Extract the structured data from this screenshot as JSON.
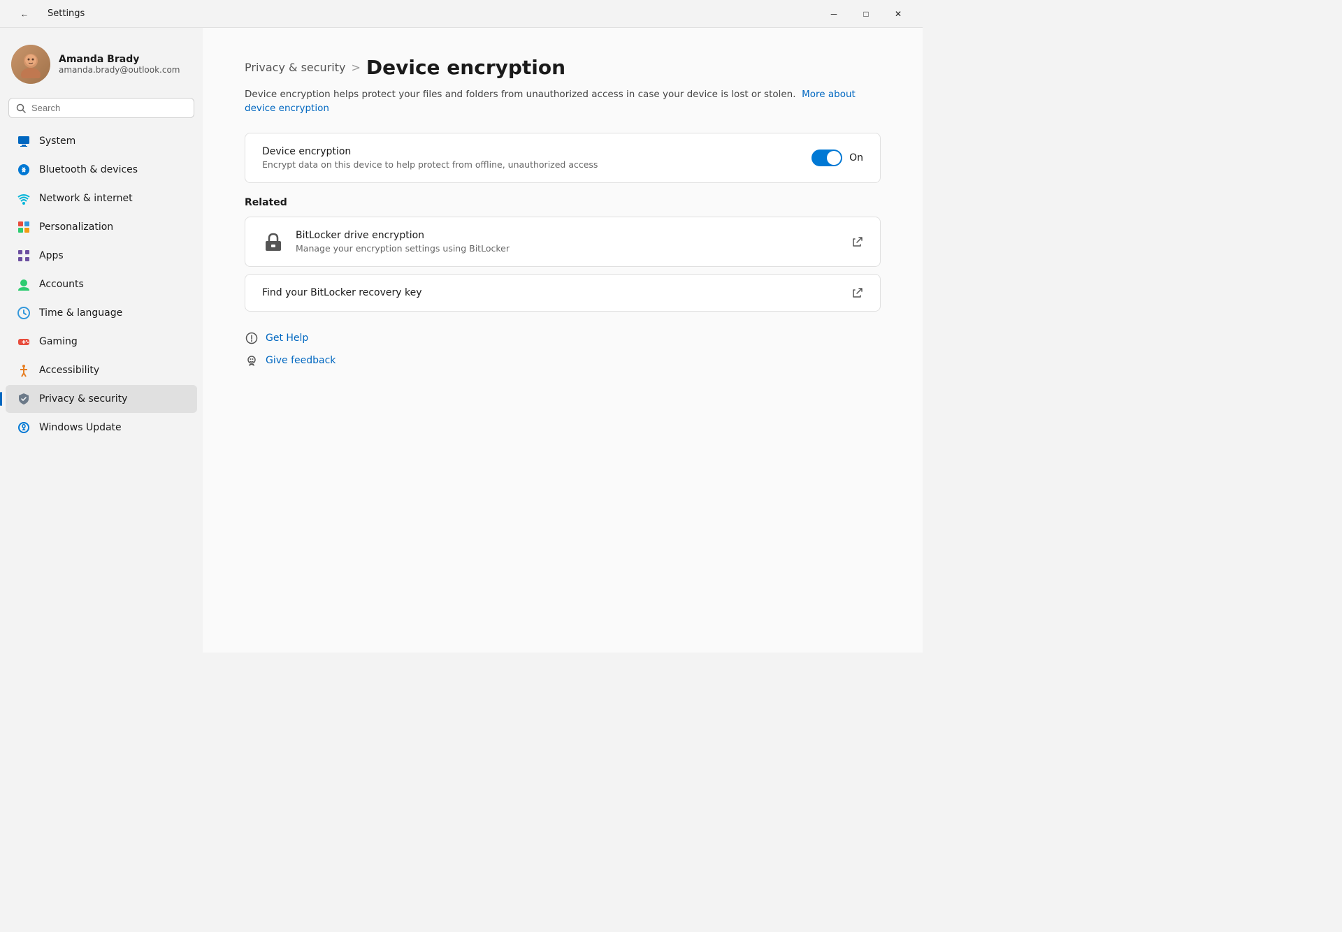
{
  "titlebar": {
    "back_icon": "←",
    "title": "Settings",
    "min_label": "─",
    "max_label": "□",
    "close_label": "✕"
  },
  "sidebar": {
    "user": {
      "name": "Amanda Brady",
      "email": "amanda.brady@outlook.com"
    },
    "search_placeholder": "Search",
    "nav_items": [
      {
        "id": "system",
        "label": "System",
        "icon_class": "icon-system"
      },
      {
        "id": "bluetooth",
        "label": "Bluetooth & devices",
        "icon_class": "icon-bluetooth"
      },
      {
        "id": "network",
        "label": "Network & internet",
        "icon_class": "icon-network"
      },
      {
        "id": "personalization",
        "label": "Personalization",
        "icon_class": "icon-personalization"
      },
      {
        "id": "apps",
        "label": "Apps",
        "icon_class": "icon-apps"
      },
      {
        "id": "accounts",
        "label": "Accounts",
        "icon_class": "icon-accounts"
      },
      {
        "id": "time",
        "label": "Time & language",
        "icon_class": "icon-time"
      },
      {
        "id": "gaming",
        "label": "Gaming",
        "icon_class": "icon-gaming"
      },
      {
        "id": "accessibility",
        "label": "Accessibility",
        "icon_class": "icon-accessibility"
      },
      {
        "id": "privacy",
        "label": "Privacy & security",
        "icon_class": "icon-privacy",
        "active": true
      },
      {
        "id": "update",
        "label": "Windows Update",
        "icon_class": "icon-update"
      }
    ]
  },
  "main": {
    "breadcrumb_parent": "Privacy & security",
    "breadcrumb_separator": ">",
    "page_title": "Device encryption",
    "description_text": "Device encryption helps protect your files and folders from unauthorized access in case your device is lost or stolen.",
    "description_link_text": "More about device encryption",
    "encryption_toggle": {
      "title": "Device encryption",
      "subtitle": "Encrypt data on this device to help protect from offline, unauthorized access",
      "state": "On",
      "enabled": true
    },
    "related_section_title": "Related",
    "related_items": [
      {
        "id": "bitlocker",
        "title": "BitLocker drive encryption",
        "subtitle": "Manage your encryption settings using BitLocker",
        "has_external": true
      },
      {
        "id": "recovery-key",
        "title": "Find your BitLocker recovery key",
        "subtitle": "",
        "has_external": true
      }
    ],
    "help_links": [
      {
        "id": "get-help",
        "label": "Get Help"
      },
      {
        "id": "give-feedback",
        "label": "Give feedback"
      }
    ]
  }
}
